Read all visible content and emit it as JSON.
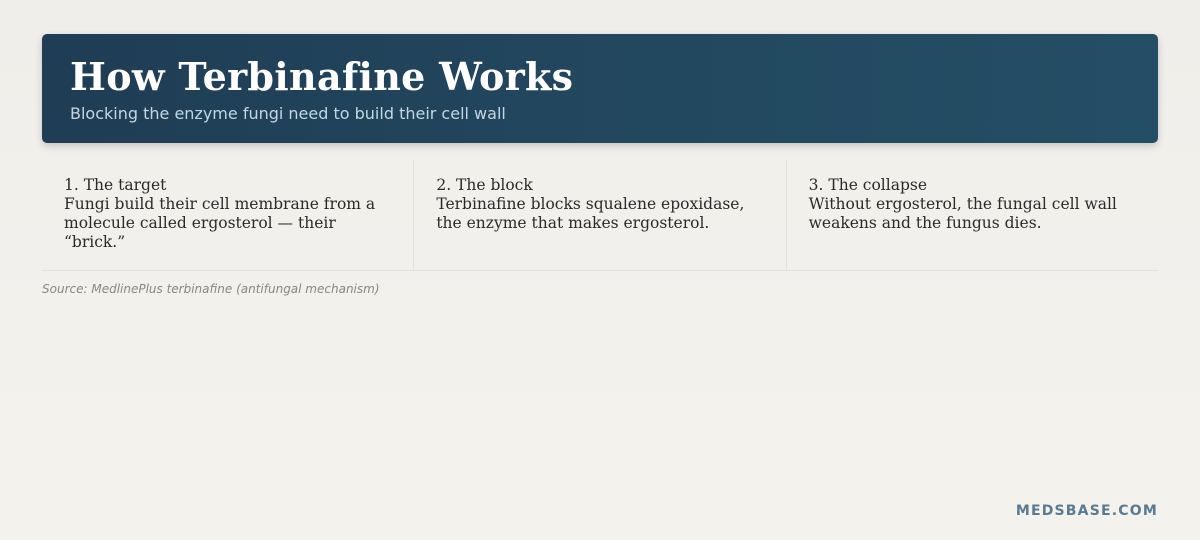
{
  "header": {
    "title": "How Terbinafine Works",
    "subtitle": "Blocking the enzyme fungi need to build their cell wall"
  },
  "steps": [
    {
      "title": "1. The target",
      "body": "Fungi build their cell membrane from a molecule called ergosterol — their “brick.”"
    },
    {
      "title": "2. The block",
      "body": "Terbinafine blocks squalene epoxidase, the enzyme that makes ergosterol."
    },
    {
      "title": "3. The collapse",
      "body": "Without ergosterol, the fungal cell wall weakens and the fungus dies."
    }
  ],
  "source": "Source: MedlinePlus terbinafine (antifungal mechanism)",
  "brand": "MEDSBASE.COM",
  "colors": {
    "header_bg": "#1f3d55",
    "subtitle": "#c4d6e3",
    "brand": "#5a7a92",
    "page_bg": "#f2f0eb"
  }
}
